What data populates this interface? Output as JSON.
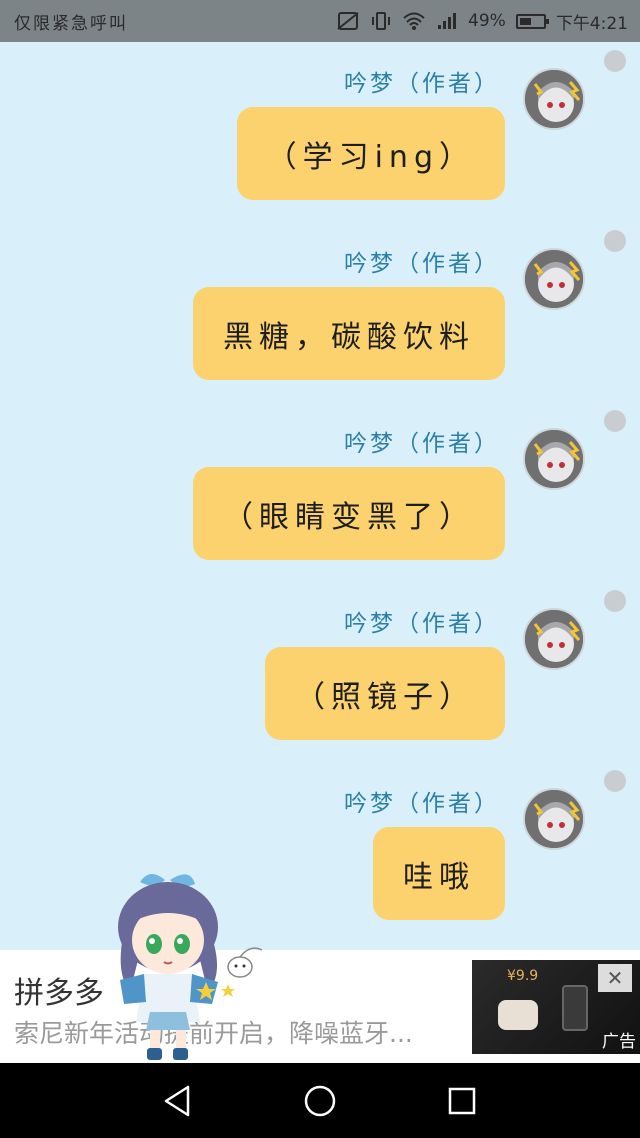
{
  "status_bar": {
    "left_text": "仅限紧急呼叫",
    "battery": "49%",
    "battery_level": 0.49,
    "time": "下午4:21",
    "icons": [
      "sim-off-icon",
      "vibrate-icon",
      "wifi-icon",
      "signal-icon"
    ]
  },
  "messages": [
    {
      "sender": "吟梦（作者）",
      "text": "（学习ing）"
    },
    {
      "sender": "吟梦（作者）",
      "text": "黑糖，碳酸饮料"
    },
    {
      "sender": "吟梦（作者）",
      "text": "（眼睛变黑了）"
    },
    {
      "sender": "吟梦（作者）",
      "text": "（照镜子）"
    },
    {
      "sender": "吟梦（作者）",
      "text": "哇哦"
    }
  ],
  "ad": {
    "title": "拼多多",
    "description": "索尼新年活动提前开启，降噪蓝牙...",
    "label": "广告",
    "price": "¥9.9",
    "close_icon": "close-icon"
  },
  "nav": {
    "icons": [
      "back-icon",
      "home-icon",
      "recents-icon"
    ]
  },
  "colors": {
    "background": "#d9f0fb",
    "bubble": "#fbd26e",
    "sender": "#2d7fa8",
    "status_bar": "#7d8488"
  }
}
